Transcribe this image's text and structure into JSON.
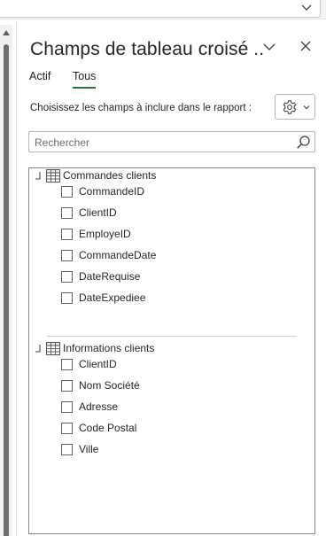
{
  "pane": {
    "title": "Champs de tableau croisé ..",
    "tabs": [
      {
        "label": "Actif",
        "selected": false
      },
      {
        "label": "Tous",
        "selected": true
      }
    ],
    "choose_fields_label": "Choisissez les champs à inclure dans le rapport :",
    "search": {
      "placeholder": "Rechercher",
      "value": ""
    }
  },
  "groups": [
    {
      "name": "Commandes clients",
      "expanded": true,
      "fields": [
        {
          "name": "CommandeID",
          "checked": false
        },
        {
          "name": "ClientID",
          "checked": false
        },
        {
          "name": "EmployeID",
          "checked": false
        },
        {
          "name": "CommandeDate",
          "checked": false
        },
        {
          "name": "DateRequise",
          "checked": false
        },
        {
          "name": "DateExpediee",
          "checked": false
        }
      ]
    },
    {
      "name": "Informations clients",
      "expanded": true,
      "fields": [
        {
          "name": "ClientID",
          "checked": false
        },
        {
          "name": "Nom Société",
          "checked": false
        },
        {
          "name": "Adresse",
          "checked": false
        },
        {
          "name": "Code Postal",
          "checked": false
        },
        {
          "name": "Ville",
          "checked": false
        }
      ]
    }
  ],
  "icons": {
    "top_dropdown": "chevron-down-icon",
    "title_options": "chevron-down-icon",
    "close": "close-icon",
    "tools": "gear-icon",
    "search": "search-icon",
    "group": "table-icon",
    "collapse": "collapse-icon"
  },
  "colors": {
    "tab_underline": "#1b7a3d",
    "text": "#262626",
    "border": "#b5b5b5"
  }
}
